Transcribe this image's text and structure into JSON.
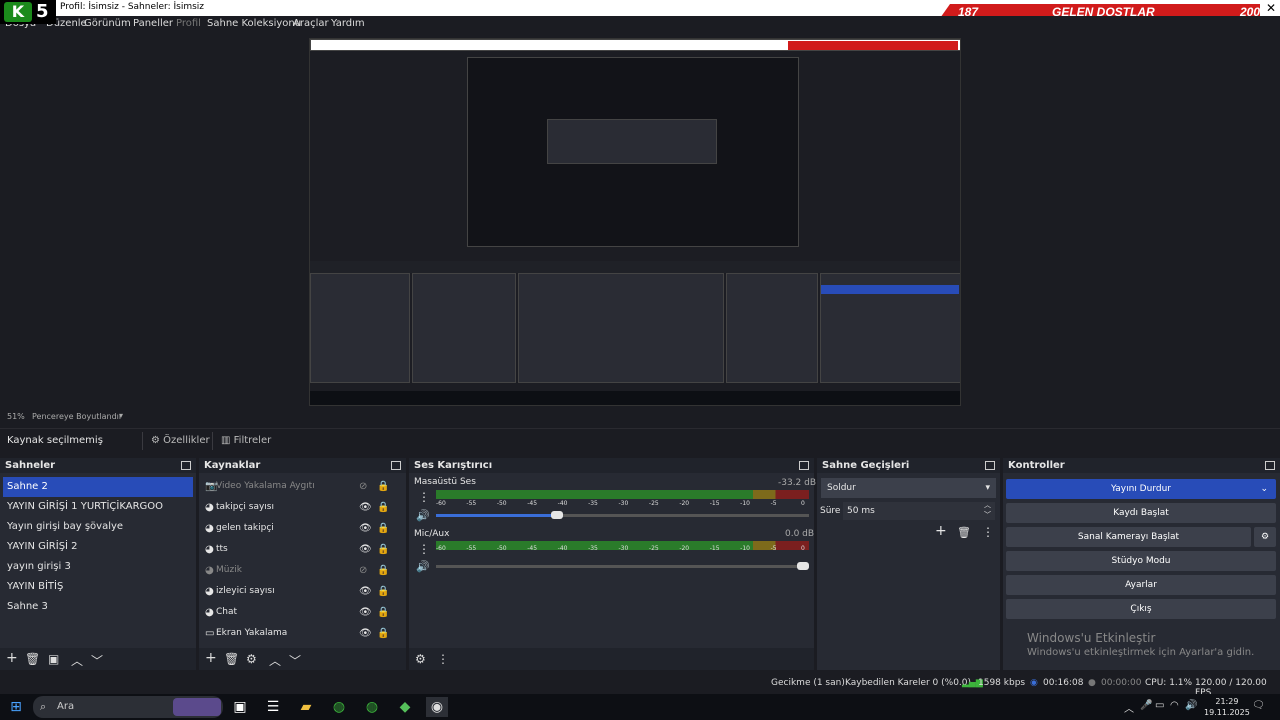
{
  "window": {
    "title": "Profil: İsimsiz - Sahneler: İsimsiz",
    "logo_letter": "K",
    "logo_number": "5"
  },
  "overlay": {
    "left_count": "187",
    "label": "GELEN DOSTLAR",
    "right_count": "200"
  },
  "menu": {
    "items": [
      "Dosya",
      "Düzenle",
      "Görünüm",
      "Paneller",
      "Profil",
      "Sahne Koleksiyonu",
      "Araçlar",
      "Yardım"
    ]
  },
  "zoom": {
    "percent": "51%",
    "mode": "Pencereye Boyutlandır"
  },
  "source_bar": {
    "none_selected": "Kaynak seçilmemiş",
    "properties": "Özellikler",
    "filters": "Filtreler"
  },
  "scenes": {
    "title": "Sahneler",
    "items": [
      "Sahne 2",
      "YAYIN GİRİŞİ 1 YURTİÇİKARGOO",
      "Yayın girişi bay şövalye",
      "YAYIN GİRİŞİ 2",
      "yayın girişi 3",
      "YAYIN BİTİŞ",
      "Sahne 3"
    ]
  },
  "sources": {
    "title": "Kaynaklar",
    "items": [
      "Video Yakalama Aygıtı",
      "takipçi sayısı",
      "gelen takipçi",
      "tts",
      "Müzik",
      "izleyici sayısı",
      "Chat",
      "Ekran Yakalama"
    ]
  },
  "mixer": {
    "title": "Ses Karıştırıcı",
    "channels": [
      {
        "name": "Masaüstü Ses",
        "db": "-33.2 dB",
        "volume_fraction": 0.34
      },
      {
        "name": "Mic/Aux",
        "db": "0.0 dB",
        "volume_fraction": 1.0
      }
    ],
    "ticks": [
      "-60",
      "-55",
      "-50",
      "-45",
      "-40",
      "-35",
      "-30",
      "-25",
      "-20",
      "-15",
      "-10",
      "-5",
      "0"
    ]
  },
  "transitions": {
    "title": "Sahne Geçişleri",
    "selected": "Soldur",
    "duration_label": "Süre",
    "duration_value": "50 ms"
  },
  "controls": {
    "title": "Kontroller",
    "stream": "Yayını Durdur",
    "record": "Kaydı Başlat",
    "vcam": "Sanal Kamerayı Başlat",
    "studio": "Stüdyo Modu",
    "settings": "Ayarlar",
    "exit": "Çıkış"
  },
  "activation": {
    "title": "Windows'u Etkinleştir",
    "subtitle": "Windows'u etkinleştirmek için Ayarlar'a gidin."
  },
  "status": {
    "delay": "Gecikme (1 san)",
    "dropped": "Kaybedilen Kareler 0 (%0.0)",
    "bitrate": "1598 kbps",
    "stream_time": "00:16:08",
    "rec_time": "00:00:00",
    "cpu": "CPU: 1.1%",
    "fps": "120.00 / 120.00 FPS"
  },
  "taskbar": {
    "search": "Ara",
    "time": "21:29",
    "date": "19.11.2025"
  },
  "colors": {
    "accent": "#284cb8",
    "overlay_red": "#d11b1b",
    "meter_green": "#2a7b2a",
    "meter_yellow": "#7d6a1b",
    "meter_red": "#7b1f1f"
  }
}
